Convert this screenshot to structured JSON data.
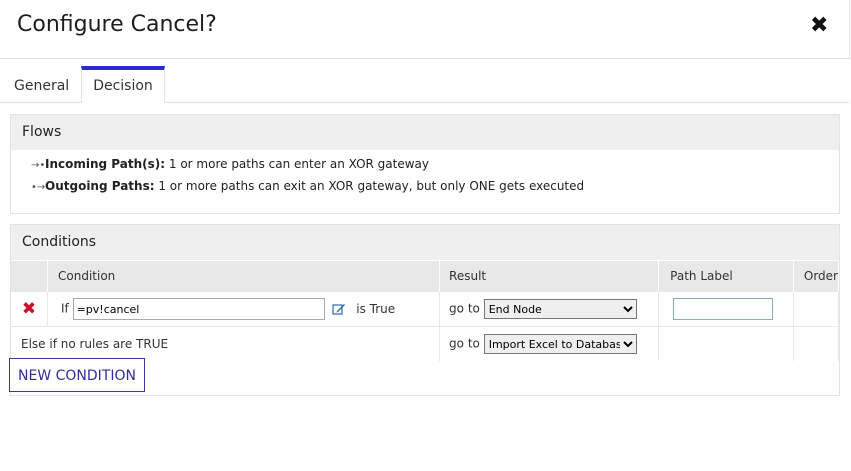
{
  "dialog": {
    "title": "Configure Cancel?",
    "close_symbol": "✖"
  },
  "tabs": [
    {
      "label": "General"
    },
    {
      "label": "Decision"
    }
  ],
  "flows": {
    "title": "Flows",
    "incoming_label": "Incoming Path(s):",
    "incoming_text": " 1 or more paths can enter an XOR gateway",
    "outgoing_label": "Outgoing Paths:",
    "outgoing_text": " 1 or more paths can exit an XOR gateway, but only ONE gets executed"
  },
  "conditions": {
    "title": "Conditions",
    "columns": [
      "Condition",
      "Result",
      "Path Label",
      "Order"
    ],
    "rows": [
      {
        "prefix": "If",
        "value": "=pv!cancel",
        "suffix": "is True",
        "goto": "go to",
        "result": "End Node",
        "path_label": ""
      }
    ],
    "else_text": "Else if no rules are TRUE",
    "else_goto": "go to",
    "else_result": "Import Excel to Database",
    "new_button": "NEW CONDITION"
  },
  "colors": {
    "accent": "#2a2ad0",
    "delete": "#c8102e"
  }
}
